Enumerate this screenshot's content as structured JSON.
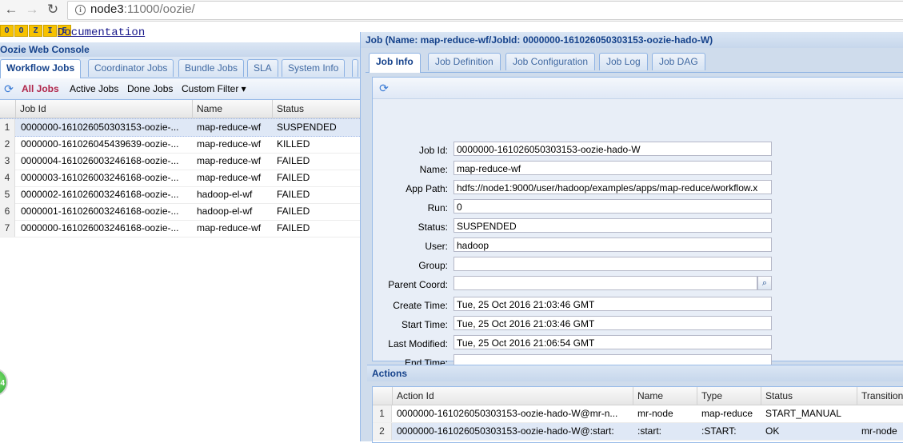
{
  "browser": {
    "url_host": "node3",
    "url_rest": ":11000/oozie/"
  },
  "header": {
    "logo_letters": [
      "O",
      "O",
      "Z",
      "I",
      "E"
    ],
    "documentation_link": "Documentation"
  },
  "left": {
    "console_title": "Oozie Web Console",
    "tabs": [
      "Workflow Jobs",
      "Coordinator Jobs",
      "Bundle Jobs",
      "SLA",
      "System Info"
    ],
    "toolbar": {
      "all_jobs": "All Jobs",
      "active_jobs": "Active Jobs",
      "done_jobs": "Done Jobs",
      "custom_filter": "Custom Filter ▾"
    },
    "columns": [
      "Job Id",
      "Name",
      "Status"
    ],
    "rows": [
      {
        "n": "1",
        "id": "0000000-161026050303153-oozie-...",
        "name": "map-reduce-wf",
        "status": "SUSPENDED"
      },
      {
        "n": "2",
        "id": "0000000-161026045439639-oozie-...",
        "name": "map-reduce-wf",
        "status": "KILLED"
      },
      {
        "n": "3",
        "id": "0000004-161026003246168-oozie-...",
        "name": "map-reduce-wf",
        "status": "FAILED"
      },
      {
        "n": "4",
        "id": "0000003-161026003246168-oozie-...",
        "name": "map-reduce-wf",
        "status": "FAILED"
      },
      {
        "n": "5",
        "id": "0000002-161026003246168-oozie-...",
        "name": "hadoop-el-wf",
        "status": "FAILED"
      },
      {
        "n": "6",
        "id": "0000001-161026003246168-oozie-...",
        "name": "hadoop-el-wf",
        "status": "FAILED"
      },
      {
        "n": "7",
        "id": "0000000-161026003246168-oozie-...",
        "name": "map-reduce-wf",
        "status": "FAILED"
      }
    ],
    "badge_text": "4"
  },
  "job_window": {
    "title": "Job (Name: map-reduce-wf/JobId: 0000000-161026050303153-oozie-hado-W)",
    "tabs": [
      "Job Info",
      "Job Definition",
      "Job Configuration",
      "Job Log",
      "Job DAG"
    ],
    "fields": [
      {
        "label": "Job Id:",
        "value": "0000000-161026050303153-oozie-hado-W"
      },
      {
        "label": "Name:",
        "value": "map-reduce-wf"
      },
      {
        "label": "App Path:",
        "value": "hdfs://node1:9000/user/hadoop/examples/apps/map-reduce/workflow.x"
      },
      {
        "label": "Run:",
        "value": "0"
      },
      {
        "label": "Status:",
        "value": "SUSPENDED"
      },
      {
        "label": "User:",
        "value": "hadoop"
      },
      {
        "label": "Group:",
        "value": ""
      },
      {
        "label": "Parent Coord:",
        "value": ""
      },
      {
        "label": "Create Time:",
        "value": "Tue, 25 Oct 2016 21:03:46 GMT"
      },
      {
        "label": "Start Time:",
        "value": "Tue, 25 Oct 2016 21:03:46 GMT"
      },
      {
        "label": "Last Modified:",
        "value": "Tue, 25 Oct 2016 21:06:54 GMT"
      },
      {
        "label": "End Time:",
        "value": ""
      }
    ],
    "actions_title": "Actions",
    "action_columns": [
      "Action Id",
      "Name",
      "Type",
      "Status",
      "Transition"
    ],
    "action_rows": [
      {
        "n": "1",
        "id": "0000000-161026050303153-oozie-hado-W@mr-n...",
        "name": "mr-node",
        "type": "map-reduce",
        "status": "START_MANUAL",
        "transition": ""
      },
      {
        "n": "2",
        "id": "0000000-161026050303153-oozie-hado-W@:start:",
        ":name": "",
        "name": ":start:",
        "type": ":START:",
        "status": "OK",
        "transition": "mr-node"
      }
    ]
  },
  "icons": {
    "back": "back-arrow-icon",
    "forward": "forward-arrow-icon",
    "reload": "reload-icon",
    "info": "info-icon",
    "refresh": "refresh-icon",
    "search": "search-icon"
  }
}
